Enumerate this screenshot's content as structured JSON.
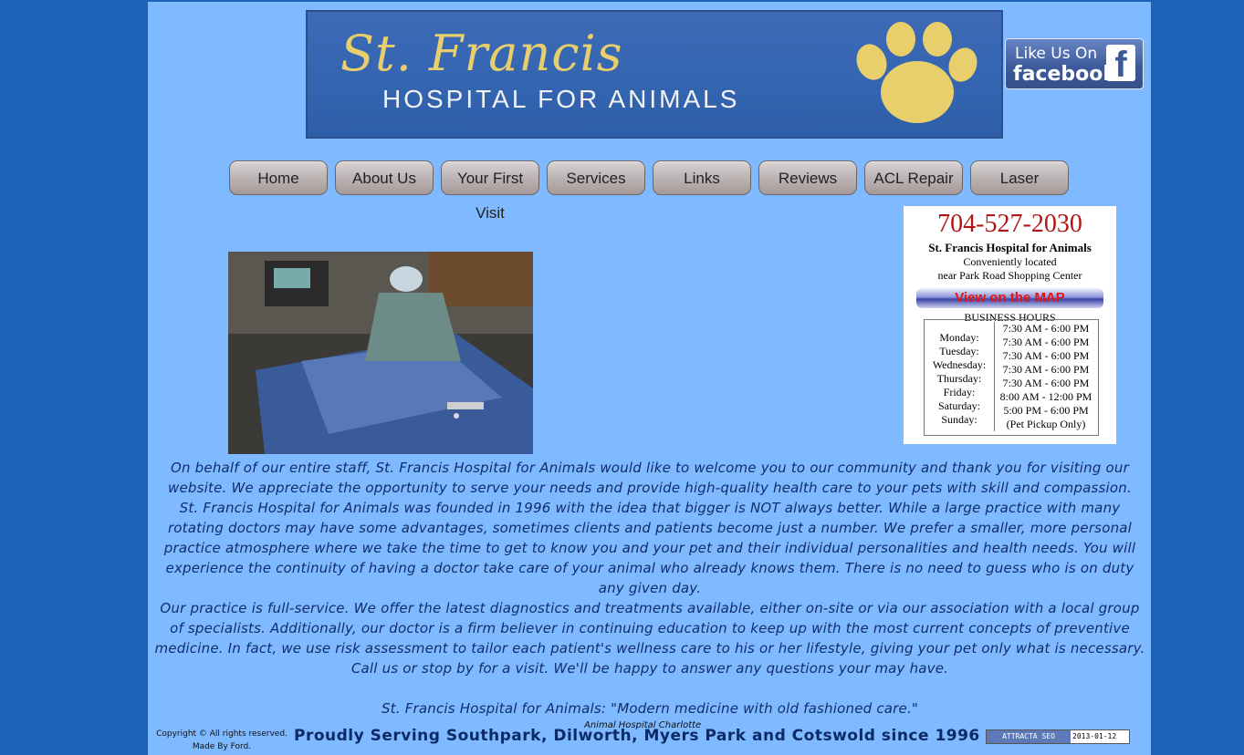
{
  "header": {
    "title": "St. Francis",
    "subtitle": "HOSPITAL FOR ANIMALS",
    "facebook_like": "Like Us On",
    "facebook_word": "facebook",
    "facebook_logo": "f"
  },
  "nav": {
    "items": [
      {
        "label": "Home"
      },
      {
        "label": "About Us"
      },
      {
        "label": "Your First Visit"
      },
      {
        "label": "Services"
      },
      {
        "label": "Links"
      },
      {
        "label": "Reviews"
      },
      {
        "label": "ACL Repair"
      },
      {
        "label": "Laser Therapy"
      }
    ]
  },
  "info": {
    "phone": "704-527-2030",
    "name": "St. Francis Hospital for Animals",
    "loc1": "Conveniently located",
    "loc2": "near Park Road Shopping Center",
    "map_button": "View on the MAP",
    "hours_title": "BUSINESS HOURS",
    "days": [
      "Monday:",
      "Tuesday:",
      "Wednesday:",
      "Thursday:",
      "Friday:",
      "Saturday:",
      "Sunday:"
    ],
    "times": [
      "7:30 AM - 6:00 PM",
      "7:30 AM - 6:00 PM",
      "7:30 AM - 6:00 PM",
      "7:30 AM - 6:00 PM",
      "7:30 AM - 6:00 PM",
      "8:00 AM - 12:00 PM",
      "5:00 PM - 6:00 PM",
      "(Pet Pickup Only)"
    ]
  },
  "body": {
    "p1": "On behalf of our entire staff, St. Francis Hospital for Animals would like to welcome you to our community and thank you for visiting our website. We appreciate the opportunity to serve your needs and provide high-quality health care to your pets with skill and compassion.",
    "p2": "St. Francis Hospital for Animals was founded in 1996 with the idea that bigger is NOT always better. While a large practice with many rotating doctors may have some advantages, sometimes clients and patients become just a number. We prefer a smaller, more personal practice atmosphere where we take the time to get to know you and your pet and their individual personalities and health needs. You will experience the continuity of having a doctor take care of your animal who already knows them. There is no need to guess who is on duty any given day.",
    "p3": "Our practice is full-service. We offer the latest diagnostics and treatments available, either on-site or via our association with a local group of specialists. Additionally, our doctor is a firm believer in continuing education to keep up with the most current concepts of preventive medicine. In fact, we use risk assessment to tailor each patient's wellness care to his or her lifestyle, giving your pet only what is necessary. Call us or stop by for a visit. We'll be happy to answer any questions your may have.",
    "tagline": "St. Francis Hospital for Animals: \"Modern medicine with old fashioned care.\""
  },
  "footer": {
    "copyright": "Copyright © All rights reserved.",
    "made_by": "Made By Ford.",
    "animal_hospital": "Animal Hospital Charlotte",
    "serving": "Proudly Serving Southpark, Dilworth, Myers Park and Cotswold since 1996",
    "attracta": "ATTRACTA SEO",
    "attracta_date": "2013-01-12"
  },
  "colors": {
    "background": "#1c62b9",
    "page": "#7fb9ff",
    "gold": "#e8cf6b",
    "phone_red": "#b01616"
  }
}
